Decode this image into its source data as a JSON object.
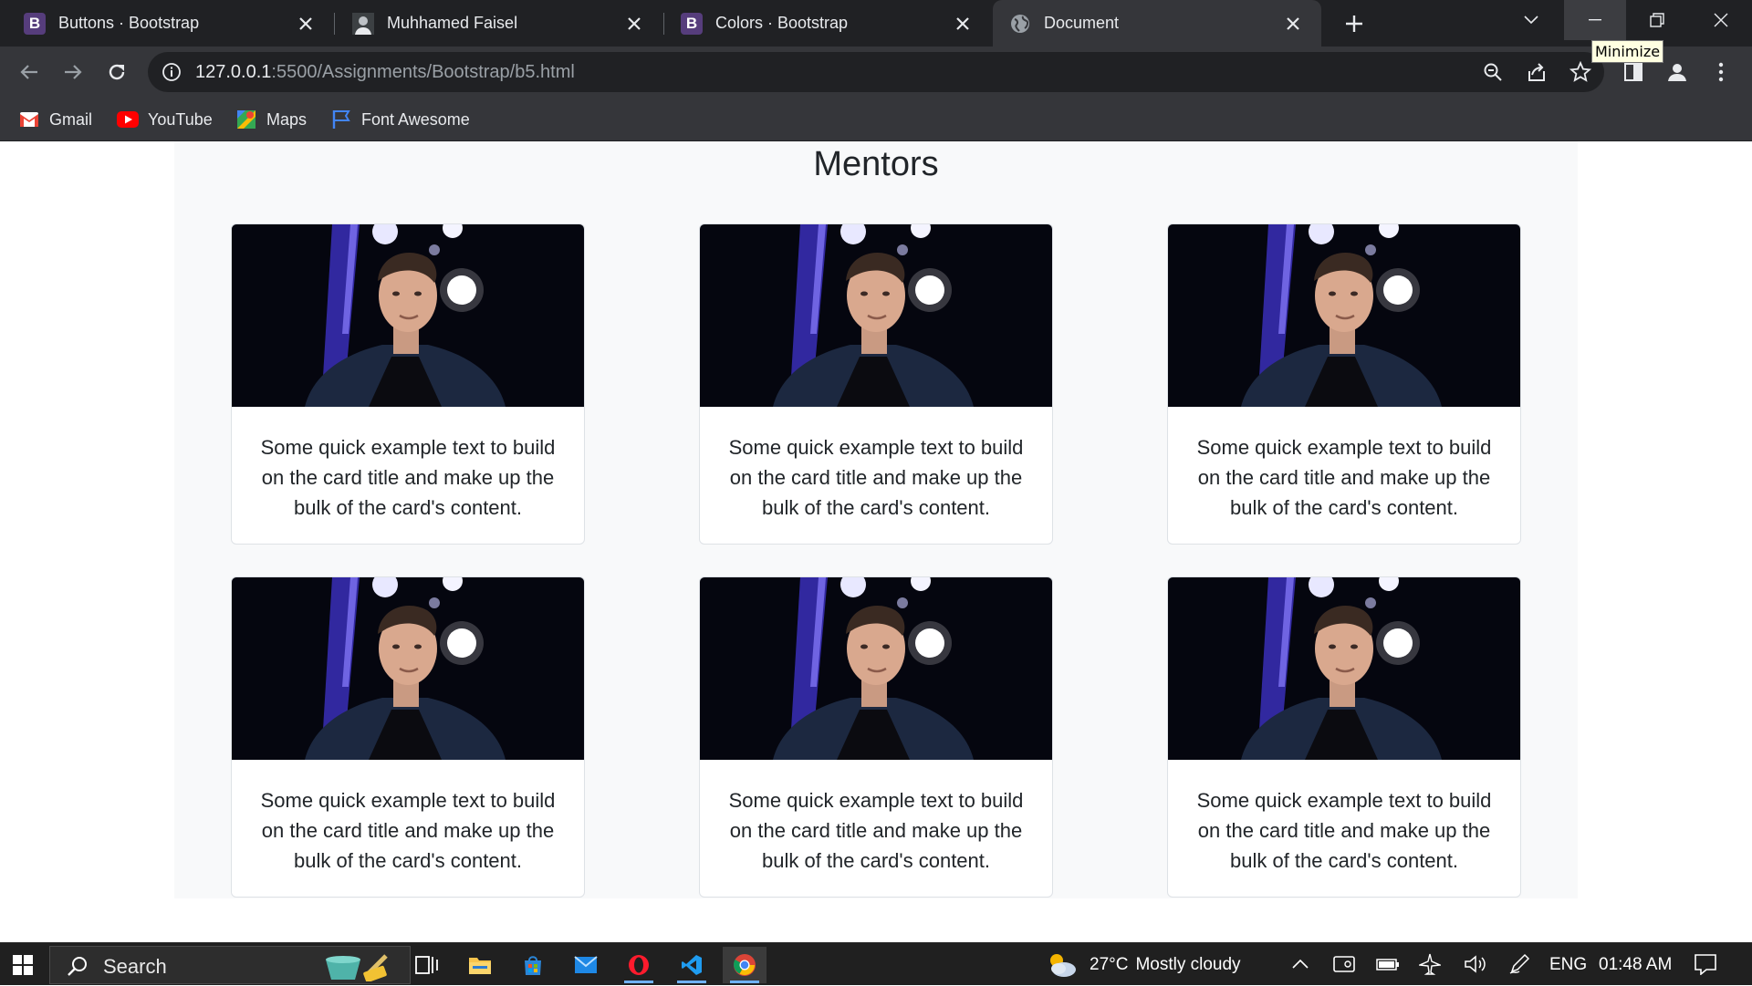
{
  "browser": {
    "tabs": [
      {
        "title": "Buttons · Bootstrap",
        "favicon": "bootstrap-icon",
        "glyph": "B"
      },
      {
        "title": "Muhhamed Faisel",
        "favicon": "user-avatar-icon",
        "glyph": ""
      },
      {
        "title": "Colors · Bootstrap",
        "favicon": "bootstrap-icon",
        "glyph": "B"
      },
      {
        "title": "Document",
        "favicon": "globe-icon",
        "glyph": ""
      }
    ],
    "active_tab": 3,
    "tooltip": "Minimize",
    "url_host": "127.0.0.1",
    "url_path": ":5500/Assignments/Bootstrap/b5.html",
    "bookmarks": [
      {
        "label": "Gmail",
        "icon": "gmail-icon"
      },
      {
        "label": "YouTube",
        "icon": "youtube-icon"
      },
      {
        "label": "Maps",
        "icon": "maps-icon"
      },
      {
        "label": "Font Awesome",
        "icon": "flag-icon"
      }
    ]
  },
  "page": {
    "heading": "Mentors",
    "cards": [
      {
        "text": "Some quick example text to build on the card title and make up the bulk of the card's content."
      },
      {
        "text": "Some quick example text to build on the card title and make up the bulk of the card's content."
      },
      {
        "text": "Some quick example text to build on the card title and make up the bulk of the card's content."
      },
      {
        "text": "Some quick example text to build on the card title and make up the bulk of the card's content."
      },
      {
        "text": "Some quick example text to build on the card title and make up the bulk of the card's content."
      },
      {
        "text": "Some quick example text to build on the card title and make up the bulk of the card's content."
      }
    ]
  },
  "taskbar": {
    "search_label": "Search",
    "weather_temp": "27°C",
    "weather_desc": "Mostly cloudy",
    "language": "ENG",
    "time": "01:48 AM"
  },
  "colors": {
    "chrome_dark": "#202124",
    "chrome_toolbar": "#35363a",
    "bootstrap_purple": "#563d7c",
    "page_bg": "#f8f9fa"
  }
}
